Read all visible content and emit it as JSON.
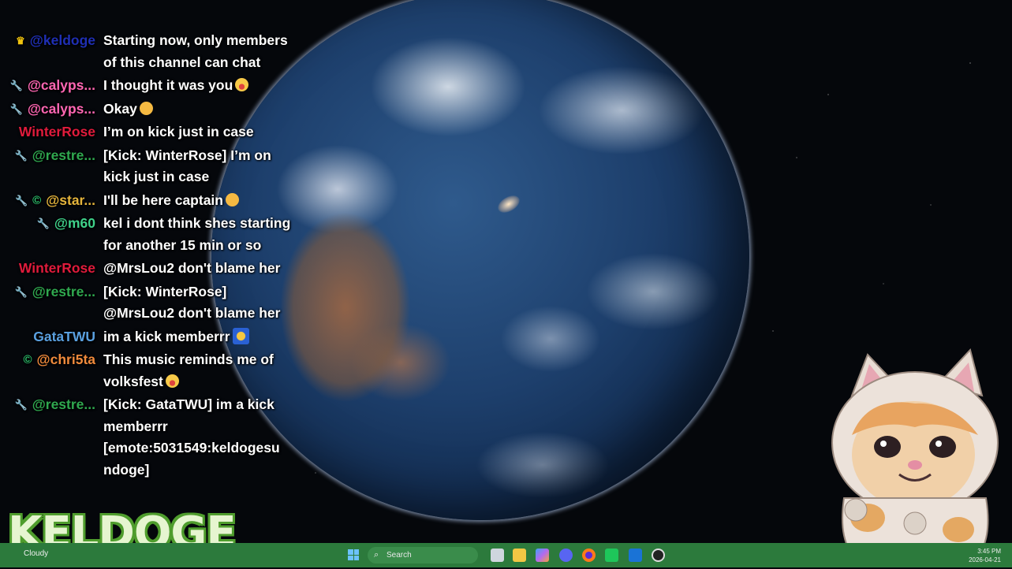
{
  "chat": [
    {
      "badges": [
        "crown"
      ],
      "user": "@keldoge",
      "color": "#1f2fb5",
      "lines": "Starting now, only members of this channel can chat",
      "emoji": ""
    },
    {
      "badges": [
        "wrench"
      ],
      "user": "@calyps...",
      "color": "#ff66b3",
      "lines": "I thought it was you",
      "emoji": "laugh"
    },
    {
      "badges": [
        "wrench"
      ],
      "user": "@calyps...",
      "color": "#ff66b3",
      "lines": "Okay",
      "emoji": "ok"
    },
    {
      "badges": [],
      "user": "WinterRose",
      "color": "#e01b3c",
      "lines": "I’m on kick just in case",
      "emoji": ""
    },
    {
      "badges": [
        "wrench"
      ],
      "user": "@restre...",
      "color": "#2fa84f",
      "lines": "[Kick: WinterRose] I’m on kick just in case",
      "emoji": ""
    },
    {
      "badges": [
        "wrench",
        "money"
      ],
      "user": "@star...",
      "color": "#e4b43c",
      "lines": "I'll be here captain",
      "emoji": "salute"
    },
    {
      "badges": [
        "wrench"
      ],
      "user": "@m60",
      "color": "#3fd18a",
      "lines": "kel i dont think shes starting for another 15 min or so",
      "emoji": ""
    },
    {
      "badges": [],
      "user": "WinterRose",
      "color": "#e01b3c",
      "lines": "@MrsLou2 don't blame her",
      "emoji": ""
    },
    {
      "badges": [
        "wrench"
      ],
      "user": "@restre...",
      "color": "#2fa84f",
      "lines": "[Kick: WinterRose] @MrsLou2 don't blame her",
      "emoji": ""
    },
    {
      "badges": [],
      "user": "GataTWU",
      "color": "#5aa0e0",
      "lines": "im a kick memberrr",
      "emoji": "sq"
    },
    {
      "badges": [
        "money"
      ],
      "user": "@chri5ta",
      "color": "#f08a3c",
      "lines": "This music reminds me of volksfest",
      "emoji": "laugh"
    },
    {
      "badges": [
        "wrench"
      ],
      "user": "@restre...",
      "color": "#2fa84f",
      "lines": "[Kick: GataTWU] im a kick memberrr [emote:5031549:keldogesu ndoge]",
      "emoji": ""
    }
  ],
  "logo": "KELDOGE",
  "taskbar": {
    "weather": "Cloudy",
    "search_label": "Search",
    "time": "3:45 PM",
    "date": "2026-04-21",
    "icons": [
      "task-view-icon",
      "file-explorer-icon",
      "copilot-icon",
      "discord-icon",
      "firefox-icon",
      "streaming-app-icon",
      "outlook-icon",
      "media-player-icon"
    ]
  }
}
